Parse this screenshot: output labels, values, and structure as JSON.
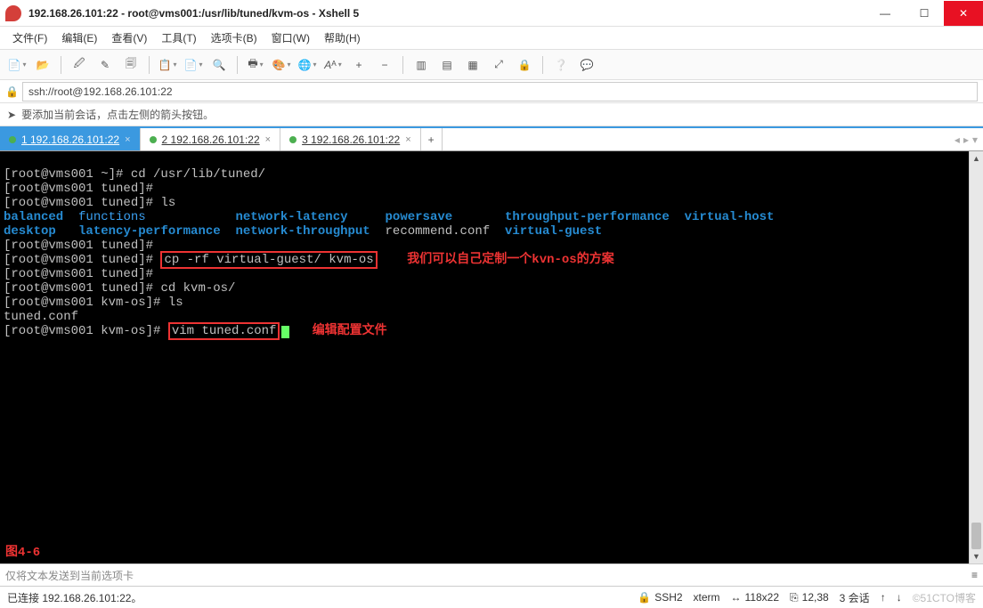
{
  "window": {
    "title": "192.168.26.101:22 - root@vms001:/usr/lib/tuned/kvm-os - Xshell 5"
  },
  "menu": {
    "file": "文件(F)",
    "edit": "编辑(E)",
    "view": "查看(V)",
    "tools": "工具(T)",
    "tabs": "选项卡(B)",
    "window": "窗口(W)",
    "help": "帮助(H)"
  },
  "address": {
    "value": "ssh://root@192.168.26.101:22"
  },
  "infobar": {
    "text": "要添加当前会话，点击左侧的箭头按钮。"
  },
  "tabs": {
    "t1": "1 192.168.26.101:22",
    "t2": "2 192.168.26.101:22",
    "t3": "3 192.168.26.101:22"
  },
  "terminal": {
    "prompt_home": "[root@vms001 ~]# ",
    "prompt_tuned": "[root@vms001 tuned]# ",
    "prompt_kvm": "[root@vms001 kvm-os]# ",
    "cmd_cd_tuned": "cd /usr/lib/tuned/",
    "cmd_ls": "ls",
    "ls": {
      "balanced": "balanced",
      "functions": "functions",
      "network_latency": "network-latency",
      "powersave": "powersave",
      "throughput": "throughput-performance",
      "virtual_host": "virtual-host",
      "desktop": "desktop",
      "latency_perf": "latency-performance",
      "network_throughput": "network-throughput",
      "recommend_conf": "recommend.conf",
      "virtual_guest": "virtual-guest"
    },
    "cmd_cp": "cp -rf virtual-guest/ kvm-os",
    "annotation_cp": "我们可以自己定制一个kvn-os的方案",
    "cmd_cd_kvm": "cd kvm-os/",
    "tuned_conf": "tuned.conf",
    "cmd_vim": "vim tuned.conf",
    "annotation_vim": "编辑配置文件",
    "figure_label": "图4-6"
  },
  "sendbar": {
    "placeholder": "仅将文本发送到当前选项卡"
  },
  "status": {
    "connected": "已连接 192.168.26.101:22。",
    "ssh": "SSH2",
    "term": "xterm",
    "size": "118x22",
    "pos": "12,38",
    "sessions": "3 会话",
    "watermark": "©51CTO博客"
  }
}
